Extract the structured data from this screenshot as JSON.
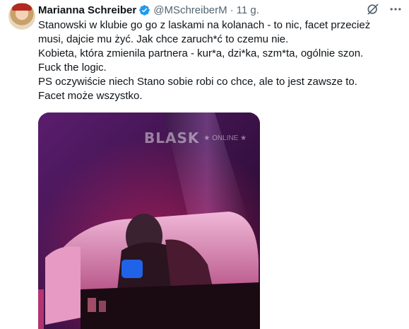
{
  "tweet": {
    "author_name": "Marianna Schreiber",
    "handle": "@MSchreiberM",
    "separator": "·",
    "time": "11 g.",
    "verified_icon": "verified-badge-icon",
    "accent_color": "#1d9bf0",
    "text_lines": [
      "Stanowski w klubie go go z laskami na kolanach - to nic, facet przecież",
      "musi, dajcie mu żyć. Jak chce zaruch*ć to czemu nie.",
      "Kobieta, która zmienila partnera - kur*a, dzi*ka, szm*ta, ogólnie szon.",
      "Fuck the logic.",
      "PS oczywiście niech Stano sobie robi co chce, ale to jest zawsze to.",
      "Facet może wszystko."
    ],
    "media": {
      "watermark_brand": "BLASK",
      "watermark_tag": "★ ONLINE ★"
    }
  },
  "actions": {
    "grok_icon": "grok-icon",
    "more_icon": "more-options-icon"
  }
}
